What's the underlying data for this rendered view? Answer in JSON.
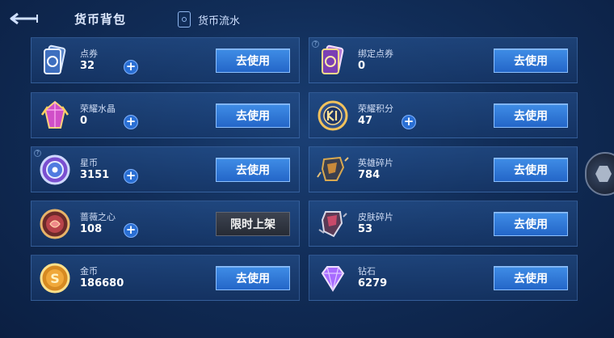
{
  "header": {
    "title": "货币背包",
    "ledger_label": "货币流水"
  },
  "currencies": [
    {
      "name": "点券",
      "amount": "32",
      "button": "去使用"
    },
    {
      "name": "绑定点券",
      "amount": "0",
      "button": "去使用"
    },
    {
      "name": "荣耀水晶",
      "amount": "0",
      "button": "去使用"
    },
    {
      "name": "荣耀积分",
      "amount": "47",
      "button": "去使用"
    },
    {
      "name": "星币",
      "amount": "3151",
      "button": "去使用"
    },
    {
      "name": "英雄碎片",
      "amount": "784",
      "button": "去使用"
    },
    {
      "name": "蔷薇之心",
      "amount": "108",
      "button": "限时上架"
    },
    {
      "name": "皮肤碎片",
      "amount": "53",
      "button": "去使用"
    },
    {
      "name": "金币",
      "amount": "186680",
      "button": "去使用"
    },
    {
      "name": "钻石",
      "amount": "6279",
      "button": "去使用"
    }
  ],
  "help_mark": "?",
  "plus_mark": "+"
}
